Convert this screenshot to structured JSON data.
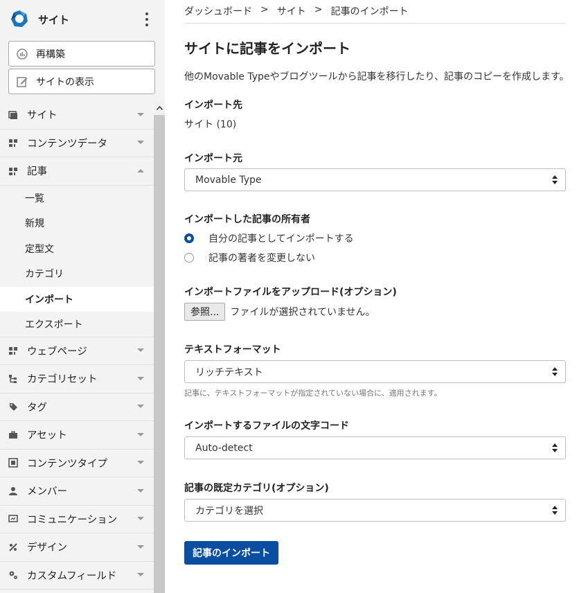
{
  "sidebar": {
    "site_name": "サイト",
    "rebuild_label": "再構築",
    "view_site_label": "サイトの表示",
    "menu": [
      {
        "label": "サイト",
        "icon": "window-icon"
      },
      {
        "label": "コンテンツデータ",
        "icon": "grid-icon"
      },
      {
        "label": "記事",
        "icon": "grid-icon",
        "expanded": true
      },
      {
        "label": "ウェブページ",
        "icon": "grid-icon"
      },
      {
        "label": "カテゴリセット",
        "icon": "tree-icon"
      },
      {
        "label": "タグ",
        "icon": "tag-icon"
      },
      {
        "label": "アセット",
        "icon": "briefcase-icon"
      },
      {
        "label": "コンテンツタイプ",
        "icon": "content-type-icon"
      },
      {
        "label": "メンバー",
        "icon": "user-icon"
      },
      {
        "label": "コミュニケーション",
        "icon": "comment-icon"
      },
      {
        "label": "デザイン",
        "icon": "design-icon"
      },
      {
        "label": "カスタムフィールド",
        "icon": "gear-icon"
      }
    ],
    "entry_submenu": [
      "一覧",
      "新規",
      "定型文",
      "カテゴリ",
      "インポート",
      "エクスポート"
    ],
    "active_submenu": "インポート"
  },
  "breadcrumb": [
    "ダッシュボード",
    "サイト",
    "記事のインポート"
  ],
  "breadcrumb_sep": ">",
  "page": {
    "title": "サイトに記事をインポート",
    "intro": "他のMovable Typeやブログツールから記事を移行したり、記事のコピーを作成します。",
    "import_to_label": "インポート先",
    "import_to_value": "サイト (10)",
    "import_from_label": "インポート元",
    "import_from_value": "Movable Type",
    "owner_label": "インポートした記事の所有者",
    "owner_options": [
      "自分の記事としてインポートする",
      "記事の著者を変更しない"
    ],
    "owner_selected": 0,
    "upload_label": "インポートファイルをアップロード(オプション)",
    "browse_label": "参照...",
    "file_status": "ファイルが選択されていません。",
    "text_format_label": "テキストフォーマット",
    "text_format_value": "リッチテキスト",
    "text_format_hint": "記事に、テキストフォーマットが指定されていない場合に、適用されます。",
    "encoding_label": "インポートするファイルの文字コード",
    "encoding_value": "Auto-detect",
    "default_category_label": "記事の既定カテゴリ(オプション)",
    "default_category_value": "カテゴリを選択",
    "submit_label": "記事のインポート"
  },
  "colors": {
    "primary": "#0a4ea2",
    "sidebar_bg": "#f3f3f3"
  }
}
